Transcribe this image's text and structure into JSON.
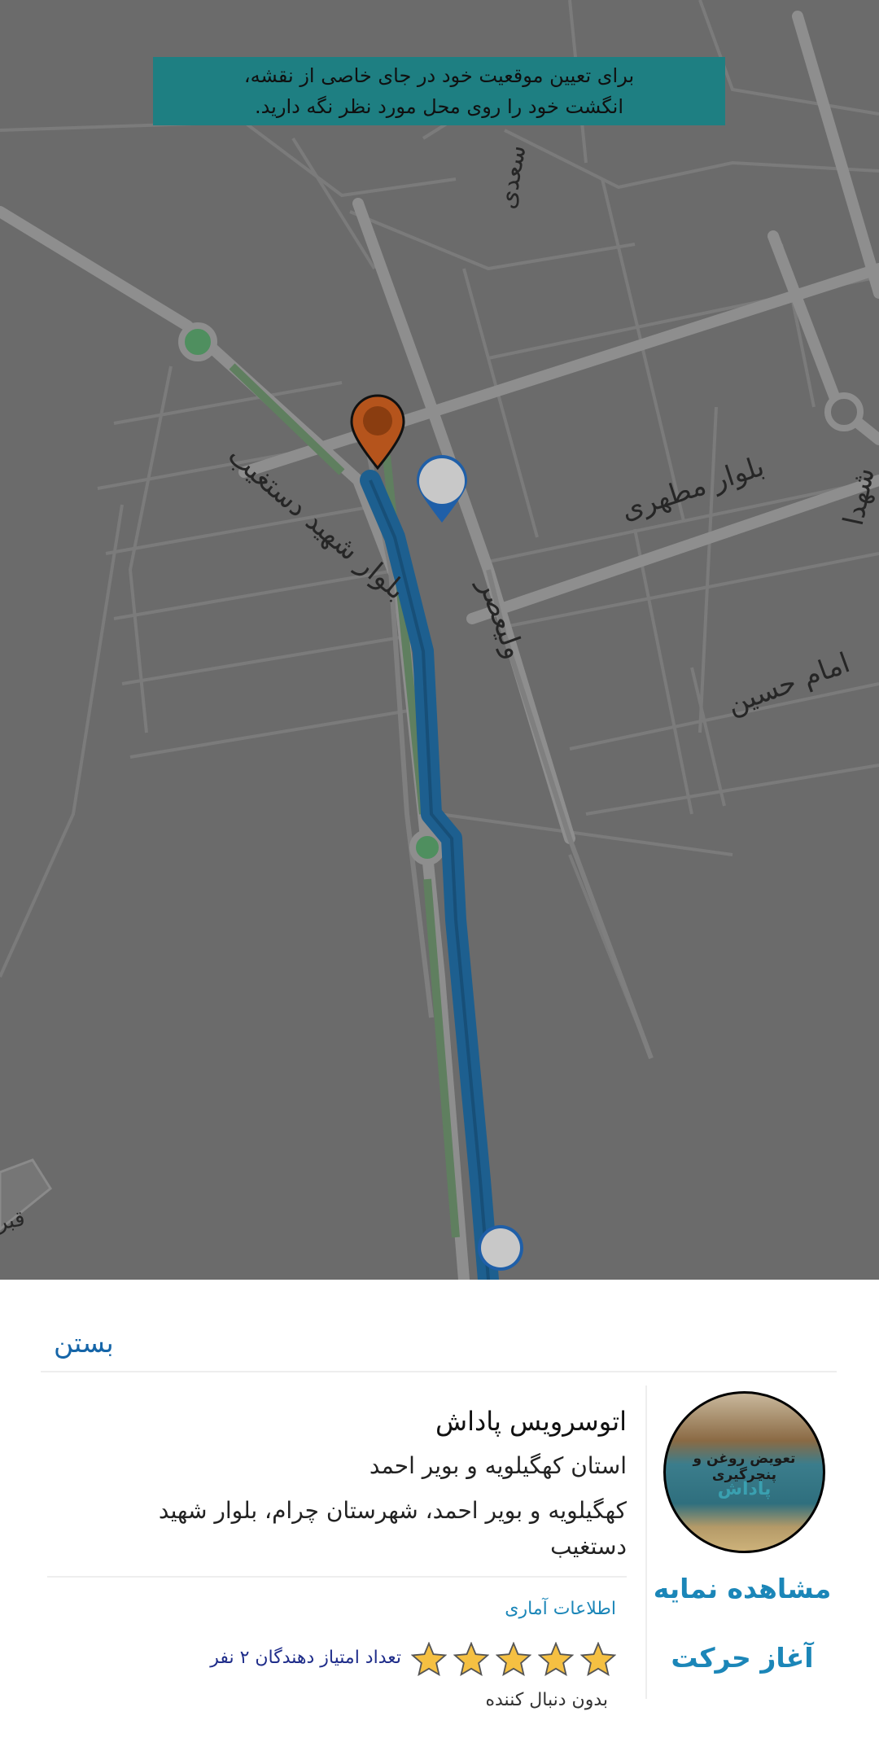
{
  "map": {
    "hint_line1": "برای تعیین موقعیت خود در جای خاصی از نقشه،",
    "hint_line2": "انگشت خود را روی محل مورد نظر نگه دارید.",
    "street_labels": {
      "saadi": "سعدی",
      "dastgheib": "بلوار شهید دستغیب",
      "motahari": "بلوار مطهری",
      "shohada": "شهدا",
      "valiasr": "ولیعصر",
      "imam_hossein": "امام حسین",
      "ghabr": "قبر"
    },
    "route_color": "#1d5f8f",
    "origin_pin_color": "#b5541c",
    "user_pin_color": "#1f5fa8"
  },
  "sheet": {
    "close_label": "بستن",
    "title": "اتوسرویس پاداش",
    "province": "استان کهگیلویه و بویر احمد",
    "address": "کهگیلویه و بویر احمد، شهرستان چرام، بلوار شهید دستغیب",
    "view_profile_label": "مشاهده نمایه",
    "start_navigation_label": "آغاز حرکت",
    "stats_label": "اطلاعات آماری",
    "rating": 5,
    "raters_label": "تعداد امتیاز دهندگان ۲ نفر",
    "followers_label": "بدون دنبال کننده",
    "avatar_sign_line1": "تعویض روغن و پنچرگیری",
    "avatar_sign_line2": "پاداش",
    "star_color": "#f5c042",
    "accent_color": "#1b86b8",
    "close_color": "#1565a8"
  }
}
